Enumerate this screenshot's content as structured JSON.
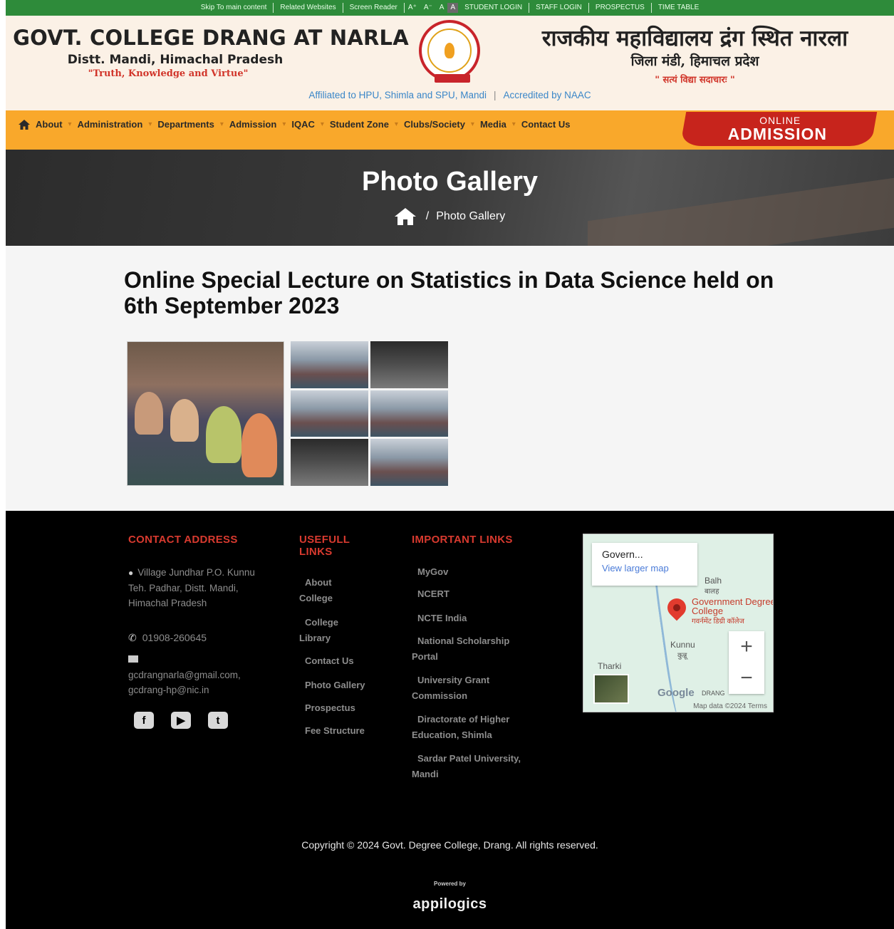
{
  "topbar": {
    "links": [
      "Skip To main content",
      "Related Websites",
      "Screen Reader"
    ],
    "font_sizes": [
      "A⁺",
      "A⁻",
      "A",
      "A"
    ],
    "right_links": [
      "STUDENT LOGIN",
      "STAFF LOGIN",
      "PROSPECTUS",
      "TIME TABLE"
    ]
  },
  "header": {
    "title_en": "GOVT. COLLEGE  DRANG AT NARLA",
    "district_en": "Distt. Mandi, Himachal Pradesh",
    "motto_en": "\"Truth, Knowledge and Virtue\"",
    "title_hi": "राजकीय महाविद्यालय द्रंग स्थित नारला",
    "district_hi": "जिला मंडी, हिमाचल प्रदेश",
    "motto_hi": "\" सत्यं विद्या सदाचारः \"",
    "affiliation": "Affiliated to HPU, Shimla and SPU, Mandi",
    "accreditation": "Accredited by NAAC"
  },
  "nav": {
    "items": [
      "About",
      "Administration",
      "Departments",
      "Admission",
      "IQAC",
      "Student Zone",
      "Clubs/Society",
      "Media",
      "Contact Us"
    ],
    "admission_top": "ONLINE",
    "admission_bottom": "ADMISSION"
  },
  "banner": {
    "title": "Photo Gallery",
    "breadcrumb_current": "Photo Gallery"
  },
  "content": {
    "heading": "Online Special Lecture on Statistics in Data Science held on 6th September 2023"
  },
  "footer": {
    "contact_heading": "CONTACT ADDRESS",
    "address": "Village Jundhar P.O. Kunnu Teh. Padhar, Distt. Mandi, Himachal Pradesh",
    "phone": "01908-260645",
    "email": "gcdrangnarla@gmail.com, gcdrang-hp@nic.in",
    "useful_heading": "USEFULL LINKS",
    "useful_links": [
      "About College",
      "College Library",
      "Contact Us",
      "Photo Gallery",
      "Prospectus",
      "Fee Structure"
    ],
    "important_heading": "IMPORTANT LINKS",
    "important_links": [
      "MyGov",
      "NCERT",
      "NCTE India",
      "National Scholarship Portal",
      "University Grant Commission",
      "Diractorate of Higher Education, Shimla",
      "Sardar Patel University, Mandi"
    ],
    "map": {
      "place": "Govern...",
      "larger_map": "View larger map",
      "label_balh": "Balh",
      "label_balh_hi": "बालह",
      "label_college": "Government Degree College",
      "label_college_hi": "गवर्नमेंट डिग्री कॉलेज",
      "label_kunnu": "Kunnu",
      "label_kunnu_hi": "कुन्नू",
      "label_tharki": "Tharki",
      "google": "Google",
      "drang": "DRANG",
      "attribution": "Map data ©2024   Terms"
    },
    "copyright": "Copyright © 2024 Govt. Degree College, Drang. All rights reserved.",
    "powered_by": "Powered by",
    "brand": "appilogics"
  }
}
